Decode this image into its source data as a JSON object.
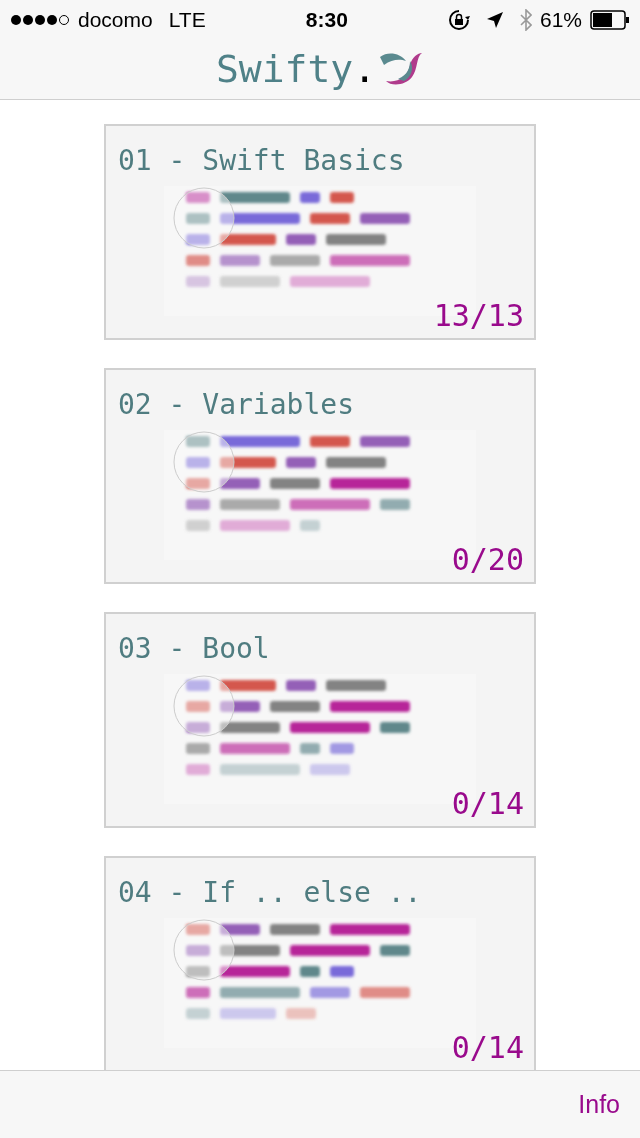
{
  "status_bar": {
    "carrier": "docomo",
    "network": "LTE",
    "time": "8:30",
    "battery": "61%"
  },
  "header": {
    "logo_text": "Swifty",
    "logo_dot": "."
  },
  "lessons": [
    {
      "title": "01 - Swift Basics",
      "progress": "13/13"
    },
    {
      "title": "02 - Variables",
      "progress": "0/20"
    },
    {
      "title": "03 - Bool",
      "progress": "0/14"
    },
    {
      "title": "04 - If .. else ..",
      "progress": "0/14"
    }
  ],
  "toolbar": {
    "info": "Info"
  }
}
